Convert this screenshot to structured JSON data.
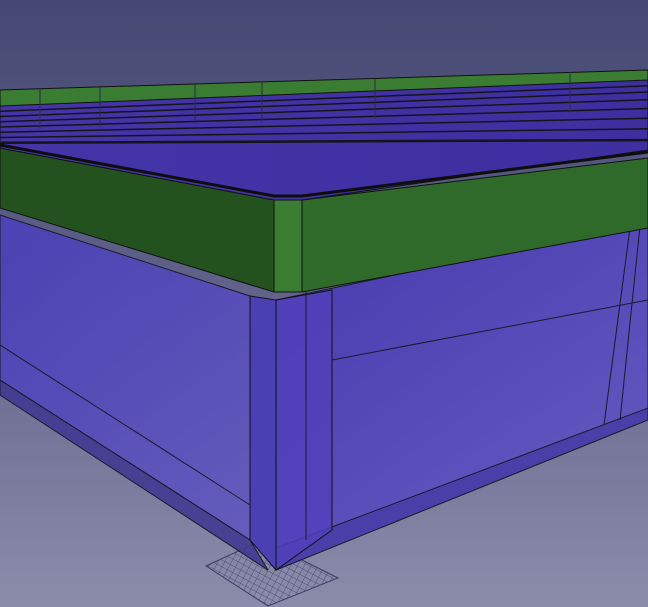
{
  "viewport": {
    "type": "3d-cad-view",
    "background": {
      "top": "#454872",
      "bottom": "#8c8caa"
    }
  },
  "model": {
    "roof_frame_color": "#2f6a2a",
    "roof_frame_top_color": "#3a7d32",
    "roof_frame_dark_color": "#23521f",
    "panel_color": "#4b3fb0",
    "panel_glass_color": "#5848c8",
    "edge_color": "#111111",
    "roof_beams": 7
  },
  "grid": {
    "label": "ground-grid",
    "color": "#3c3c66"
  }
}
